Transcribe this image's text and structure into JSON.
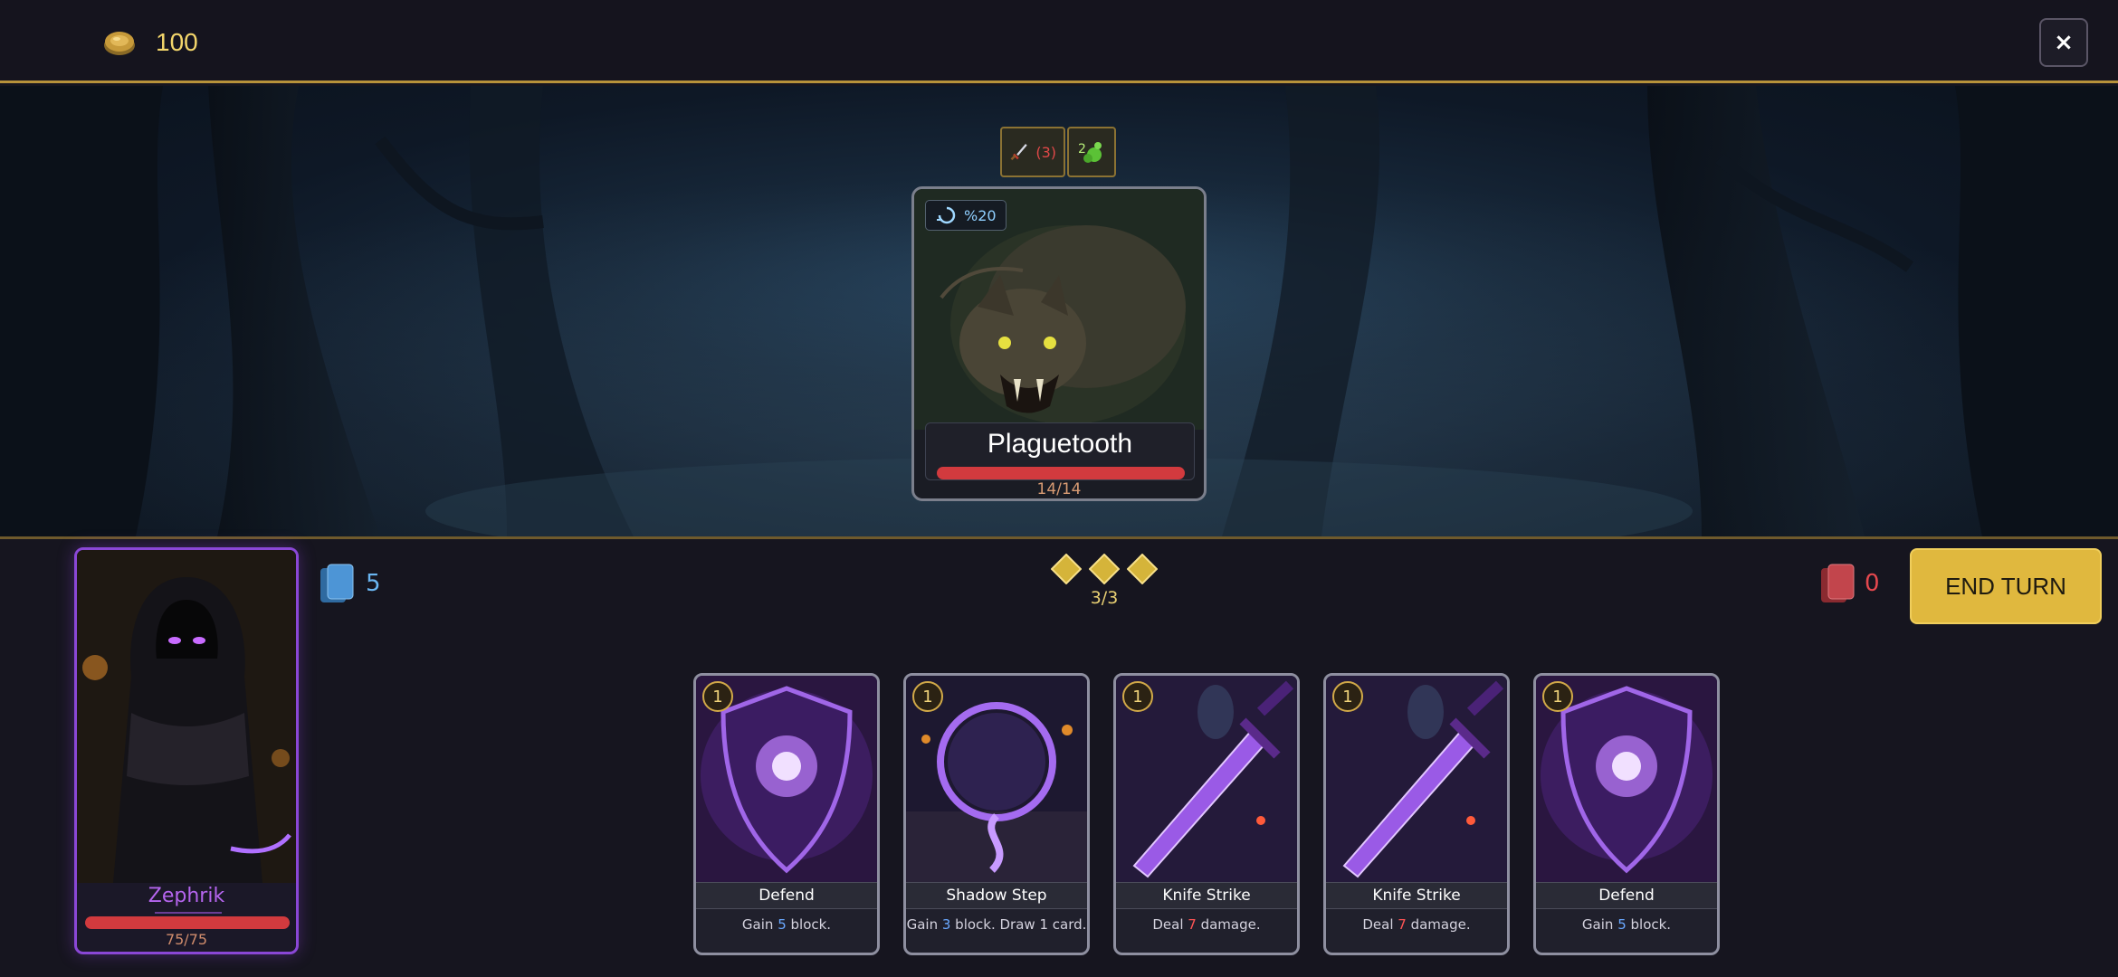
{
  "header": {
    "gold": "100",
    "close_label": "×"
  },
  "enemy": {
    "name": "Plaguetooth",
    "hp_text": "14/14",
    "hp_fraction": 1.0,
    "intent_value": "%20",
    "statuses": [
      {
        "icon": "sword-icon",
        "value": "(3)"
      },
      {
        "icon": "poison-icon",
        "value": "2"
      }
    ]
  },
  "hero": {
    "name": "Zephrik",
    "hp_text": "75/75",
    "hp_fraction": 1.0
  },
  "piles": {
    "draw_count": "5",
    "discard_count": "0"
  },
  "energy": {
    "text": "3/3",
    "current": 3,
    "max": 3
  },
  "end_turn_label": "END TURN",
  "hand": [
    {
      "cost": "1",
      "title": "Defend",
      "desc_pre": "Gain ",
      "desc_num": "5",
      "desc_post": " block.",
      "num_color": "blue",
      "art": "shield"
    },
    {
      "cost": "1",
      "title": "Shadow Step",
      "desc_pre": "Gain ",
      "desc_num": "3",
      "desc_post": " block. Draw 1 card.",
      "num_color": "blue",
      "art": "portal"
    },
    {
      "cost": "1",
      "title": "Knife Strike",
      "desc_pre": "Deal ",
      "desc_num": "7",
      "desc_post": " damage.",
      "num_color": "red",
      "art": "dagger"
    },
    {
      "cost": "1",
      "title": "Knife Strike",
      "desc_pre": "Deal ",
      "desc_num": "7",
      "desc_post": " damage.",
      "num_color": "red",
      "art": "dagger"
    },
    {
      "cost": "1",
      "title": "Defend",
      "desc_pre": "Gain ",
      "desc_num": "5",
      "desc_post": " block.",
      "num_color": "blue",
      "art": "shield"
    }
  ],
  "colors": {
    "gold": "#f3d66b",
    "hp": "#d23a3e",
    "hero_border": "#8a47d6",
    "end_turn": "#e0b83e"
  }
}
